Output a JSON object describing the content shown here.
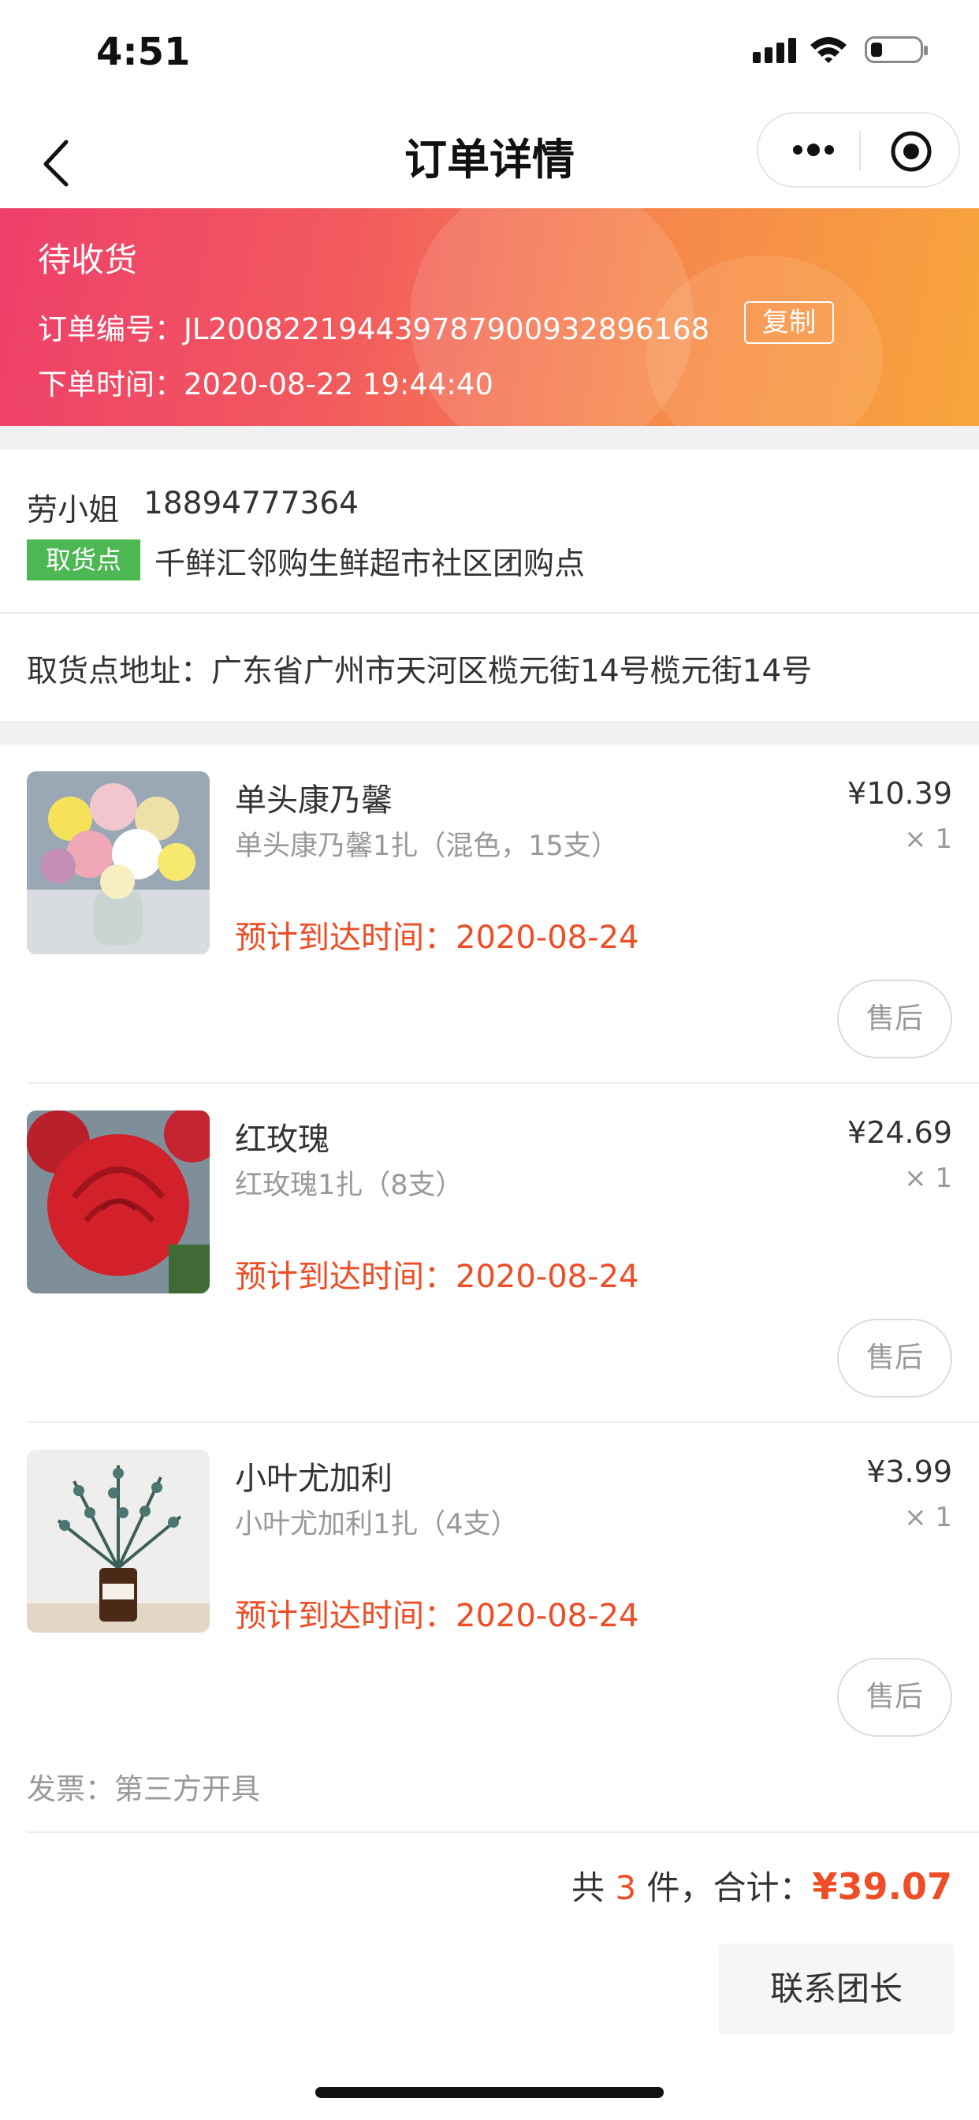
{
  "status_bar": {
    "time": "4:51"
  },
  "nav": {
    "title": "订单详情"
  },
  "banner": {
    "status": "待收货",
    "order_no_label": "订单编号：",
    "order_no": "JL2008221944397879009328961​68",
    "copy_label": "复制",
    "order_time_label": "下单时间：",
    "order_time": "2020-08-22 19:44:40"
  },
  "recipient": {
    "name": "劳小姐",
    "phone": "18894777364",
    "pick_tag": "取货点",
    "pick_point": "千鲜汇邻购生鲜超市社区团购点",
    "address_label": "取货点地址：",
    "address": "广东省广州市天河区榄元街14号榄元街14号"
  },
  "products": [
    {
      "name": "单头康乃馨",
      "spec": "单头康乃馨1扎（混色，15支）",
      "price": "¥10.39",
      "qty": "× 1",
      "eta_label": "预计到达时间：",
      "eta": "2020-08-24",
      "after_sale": "售后"
    },
    {
      "name": "红玫瑰",
      "spec": "红玫瑰1扎（8支）",
      "price": "¥24.69",
      "qty": "× 1",
      "eta_label": "预计到达时间：",
      "eta": "2020-08-24",
      "after_sale": "售后"
    },
    {
      "name": "小叶尤加利",
      "spec": "小叶尤加利1扎（4支）",
      "price": "¥3.99",
      "qty": "× 1",
      "eta_label": "预计到达时间：",
      "eta": "2020-08-24",
      "after_sale": "售后"
    }
  ],
  "invoice": {
    "label": "发票：",
    "value": "第三方开具"
  },
  "summary": {
    "prefix": "共 ",
    "count": "3",
    "middle": " 件，合计：",
    "amount": "¥39.07"
  },
  "actions": {
    "contact": "联系团长"
  },
  "colors": {
    "accent": "#ee4d25",
    "tag_green": "#4cb753",
    "banner_start": "#ee3f6a",
    "banner_end": "#f8a53d"
  }
}
